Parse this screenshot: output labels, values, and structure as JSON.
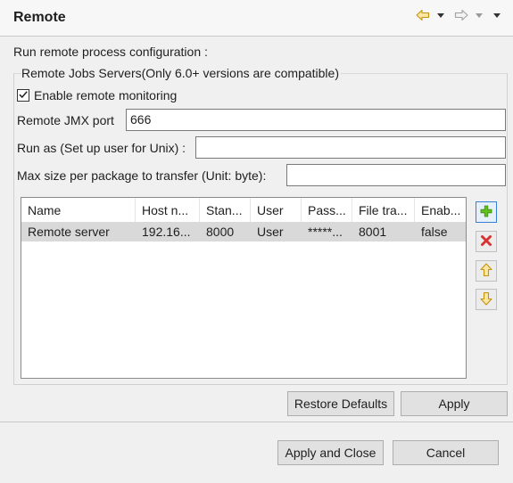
{
  "header": {
    "title": "Remote"
  },
  "nav_icons": [
    "back-arrow-icon",
    "dropdown-arrow-icon",
    "forward-arrow-icon",
    "dropdown-arrow-icon",
    "view-menu-icon"
  ],
  "main": {
    "subtitle": "Run remote process configuration :",
    "group_title": "Remote Jobs Servers(Only 6.0+ versions are compatible)",
    "enable_monitoring_label": "Enable remote monitoring",
    "enable_monitoring_checked": true,
    "jmx_port_label": "Remote JMX port",
    "jmx_port_value": "666",
    "run_as_label": "Run as (Set up user for Unix) :",
    "run_as_value": "",
    "max_size_label": "Max size per package to transfer (Unit: byte):",
    "max_size_value": ""
  },
  "table": {
    "columns": [
      "Name",
      "Host n...",
      "Stan...",
      "User",
      "Pass...",
      "File tra...",
      "Enab..."
    ],
    "rows": [
      [
        "Remote server",
        "192.16...",
        "8000",
        "User",
        "*****...",
        "8001",
        "false"
      ]
    ]
  },
  "side_buttons": [
    "add-icon",
    "delete-icon",
    "move-up-icon",
    "move-down-icon"
  ],
  "buttons": {
    "restore_defaults": "Restore Defaults",
    "apply": "Apply",
    "apply_and_close": "Apply and Close",
    "cancel": "Cancel"
  },
  "colors": {
    "accent_add": "#4caf1e",
    "delete": "#d63333",
    "arrow": "#d9a21b",
    "selected_row": "#d9d9d9"
  }
}
